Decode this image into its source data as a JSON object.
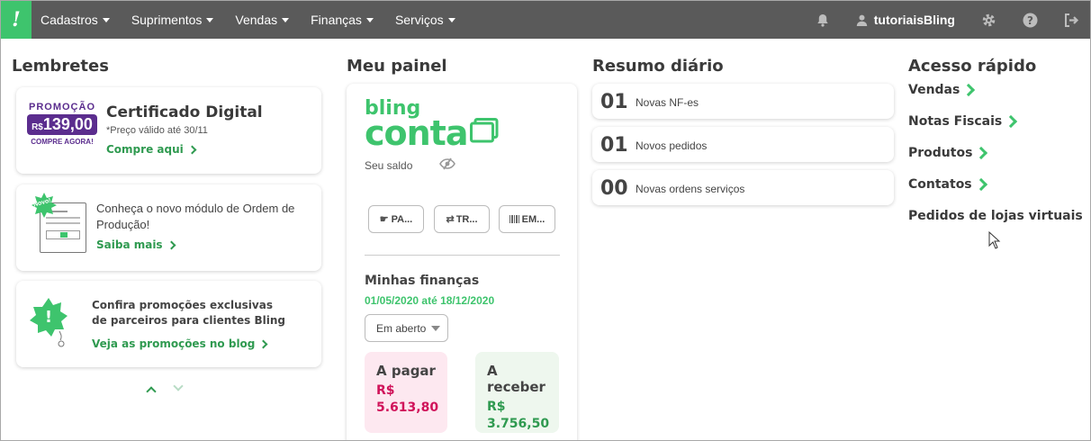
{
  "nav": {
    "logo": "!",
    "menu": [
      {
        "label": "Cadastros"
      },
      {
        "label": "Suprimentos"
      },
      {
        "label": "Vendas"
      },
      {
        "label": "Finanças"
      },
      {
        "label": "Serviços"
      }
    ],
    "username": "tutoriaisBling"
  },
  "lembretes": {
    "title": "Lembretes",
    "promo": {
      "badge_top": "PROMOÇÃO",
      "badge_currency": "R$",
      "badge_price": "139,00",
      "badge_bottom": "COMPRE AGORA!",
      "title": "Certificado Digital",
      "subtitle": "*Preço válido até 30/11",
      "link": "Compre aqui"
    },
    "producao": {
      "badge": "Novo!",
      "text": "Conheça o novo módulo de Ordem de Produção!",
      "link": "Saiba mais"
    },
    "parceiros": {
      "text": "Confira promoções exclusivas de parceiros para clientes Bling",
      "link": "Veja as promoções no blog"
    }
  },
  "painel": {
    "title": "Meu painel",
    "brand_top": "bling",
    "brand_bottom": "conta",
    "saldo_label": "Seu saldo",
    "actions": [
      {
        "label": "PA..."
      },
      {
        "label": "TR..."
      },
      {
        "label": "EM..."
      }
    ],
    "financas_title": "Minhas finanças",
    "date_range": "01/05/2020 até 18/12/2020",
    "filter_selected": "Em aberto",
    "a_pagar": {
      "label": "A pagar",
      "currency": "R$",
      "value": "5.613,80"
    },
    "a_receber": {
      "label": "A receber",
      "currency": "R$",
      "value": "3.756,50"
    }
  },
  "resumo": {
    "title": "Resumo diário",
    "items": [
      {
        "count": "01",
        "label": "Novas NF-es"
      },
      {
        "count": "01",
        "label": "Novos pedidos"
      },
      {
        "count": "00",
        "label": "Novas ordens serviços"
      }
    ]
  },
  "acesso": {
    "title": "Acesso rápido",
    "links": [
      {
        "label": "Vendas"
      },
      {
        "label": "Notas Fiscais"
      },
      {
        "label": "Produtos"
      },
      {
        "label": "Contatos"
      },
      {
        "label": "Pedidos de lojas virtuais"
      }
    ]
  },
  "colors": {
    "topbar": "#5a5a5a",
    "brand_green": "#3ec46d",
    "link_green": "#2f9a50",
    "promo_purple": "#5b2d8e",
    "pagar_bg": "#fde8f0",
    "pagar_text": "#d0135a",
    "receber_bg": "#eef7ee",
    "receber_text": "#2f9a50"
  }
}
